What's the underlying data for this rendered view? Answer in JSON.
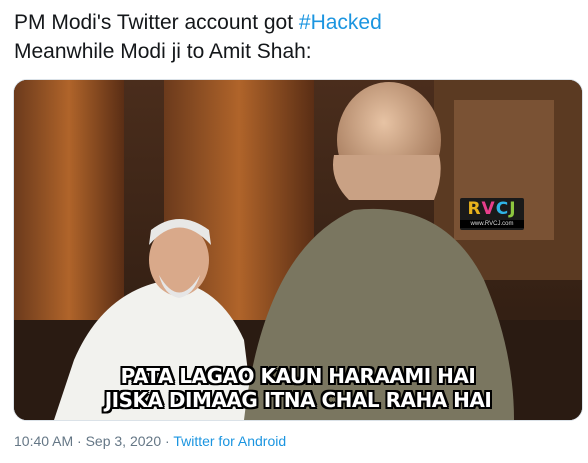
{
  "tweet": {
    "line1_prefix": "PM Modi's Twitter account got ",
    "hashtag": "#Hacked",
    "line2": "Meanwhile Modi ji to Amit Shah:"
  },
  "media": {
    "watermark_logo_letters": [
      "R",
      "V",
      "C",
      "J"
    ],
    "watermark_url": "www.RVCJ.com",
    "caption_line1": "PATA LAGAO KAUN HARAAMI HAI",
    "caption_line2": "JISKA DIMAAG ITNA CHAL RAHA HAI"
  },
  "meta": {
    "timestamp": "10:40 AM · Sep 3, 2020",
    "separator": " · ",
    "source": "Twitter for Android"
  },
  "colors": {
    "text": "#14171a",
    "link": "#1b95e0",
    "meta": "#657786"
  }
}
